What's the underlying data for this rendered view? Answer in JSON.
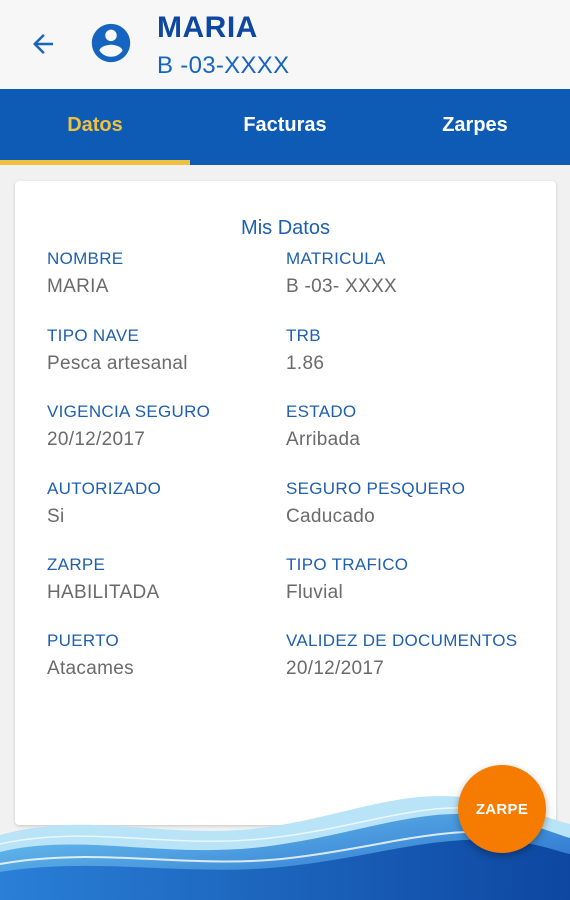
{
  "header": {
    "title": "MARIA",
    "subtitle": "B -03-XXXX",
    "back_icon": "arrow-back-icon",
    "avatar_icon": "account-circle-icon"
  },
  "tabs": [
    {
      "label": "Datos",
      "active": true
    },
    {
      "label": "Facturas",
      "active": false
    },
    {
      "label": "Zarpes",
      "active": false
    }
  ],
  "card": {
    "title": "Mis Datos",
    "fields": [
      {
        "label": "NOMBRE",
        "value": "MARIA"
      },
      {
        "label": "MATRICULA",
        "value": "B -03- XXXX"
      },
      {
        "label": "TIPO NAVE",
        "value": "Pesca artesanal"
      },
      {
        "label": "TRB",
        "value": "1.86"
      },
      {
        "label": "VIGENCIA SEGURO",
        "value": "20/12/2017"
      },
      {
        "label": "ESTADO",
        "value": "Arribada"
      },
      {
        "label": "AUTORIZADO",
        "value": "Si"
      },
      {
        "label": "SEGURO PESQUERO",
        "value": "Caducado"
      },
      {
        "label": "ZARPE",
        "value": "HABILITADA"
      },
      {
        "label": "TIPO TRAFICO",
        "value": "Fluvial"
      },
      {
        "label": "PUERTO",
        "value": "Atacames"
      },
      {
        "label": "VALIDEZ DE DOCUMENTOS",
        "value": "20/12/2017"
      }
    ]
  },
  "fab": {
    "label": "ZARPE"
  },
  "colors": {
    "primary": "#0d5bb5",
    "accent": "#f0c040",
    "fab": "#f57c00",
    "label": "#1e5fae",
    "value": "#6a6a6a"
  }
}
